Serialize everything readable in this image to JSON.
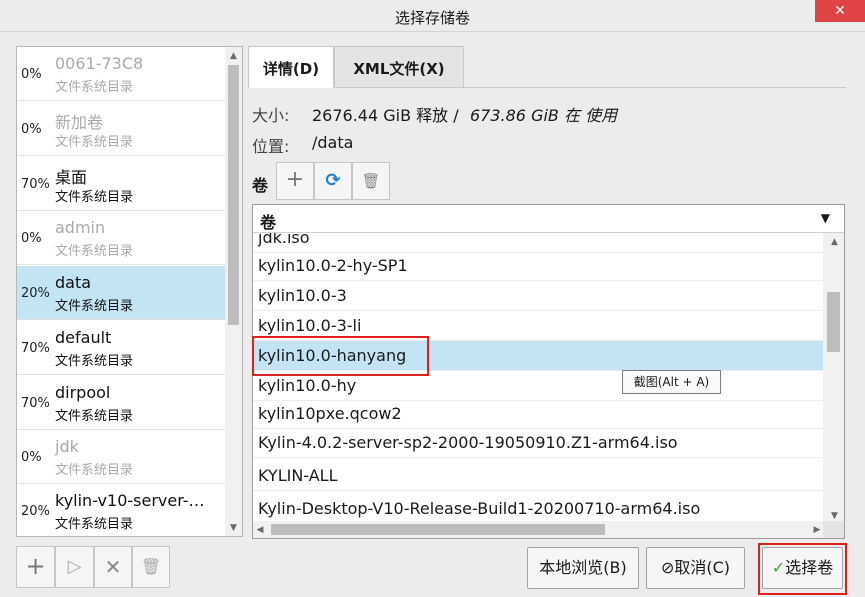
{
  "window": {
    "title": "选择存储卷",
    "close_label": "✕"
  },
  "pools": [
    {
      "percent": "0%",
      "name": "0061-73C8",
      "type": "文件系统目录",
      "active": false
    },
    {
      "percent": "0%",
      "name": "新加卷",
      "type": "文件系统目录",
      "active": false
    },
    {
      "percent": "70%",
      "name": "桌面",
      "type": "文件系统目录",
      "active": true
    },
    {
      "percent": "0%",
      "name": "admin",
      "type": "文件系统目录",
      "active": false
    },
    {
      "percent": "20%",
      "name": "data",
      "type": "文件系统目录",
      "active": true,
      "selected": true
    },
    {
      "percent": "70%",
      "name": "default",
      "type": "文件系统目录",
      "active": true
    },
    {
      "percent": "70%",
      "name": "dirpool",
      "type": "文件系统目录",
      "active": true
    },
    {
      "percent": "0%",
      "name": "jdk",
      "type": "文件系统目录",
      "active": false
    },
    {
      "percent": "20%",
      "name": "kylin-v10-server-…",
      "type": "文件系统目录",
      "active": true
    }
  ],
  "pool_toolbar": {
    "add": "+",
    "start": "▷",
    "stop": "✕",
    "delete": "🗑"
  },
  "tabs": [
    {
      "label": "详情(D)",
      "active": true
    },
    {
      "label": "XML文件(X)",
      "active": false
    }
  ],
  "details": {
    "size_label": "大小:",
    "size_free": "2676.44 GiB 释放 /",
    "size_used": "673.86 GiB 在 使用",
    "location_label": "位置:",
    "location_value": "/data"
  },
  "volumes_toolbar": {
    "label": "卷",
    "add": "+",
    "refresh": "⟳",
    "delete": "🗑"
  },
  "volumes": {
    "column_header": "卷",
    "rows": [
      "jdk.iso",
      "kylin10.0-2-hy-SP1",
      "kylin10.0-3",
      "kylin10.0-3-li",
      "kylin10.0-hanyang",
      "kylin10.0-hy",
      "kylin10pxe.qcow2",
      "Kylin-4.0.2-server-sp2-2000-19050910.Z1-arm64.iso",
      "KYLIN-ALL",
      "Kylin-Desktop-V10-Release-Build1-20200710-arm64.iso"
    ],
    "selected": "kylin10.0-hanyang"
  },
  "tooltip": "截图(Alt + A)",
  "footer": {
    "browse_local": "本地浏览(B)",
    "cancel": "取消(C)",
    "cancel_icon": "⊘",
    "choose": "选择卷",
    "choose_icon": "✓"
  },
  "colors": {
    "selection": "#c2e4f3",
    "highlight_box": "#e01e1e",
    "close": "#e04343"
  }
}
